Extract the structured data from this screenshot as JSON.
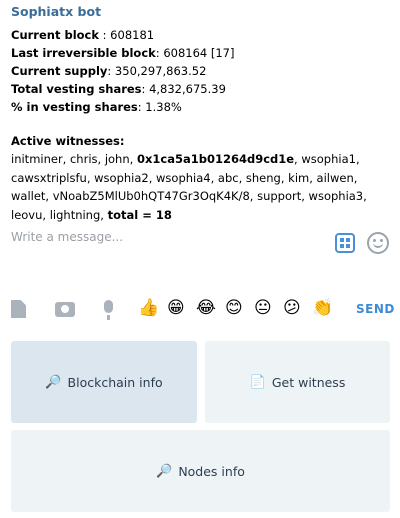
{
  "message": {
    "sender": "Sophiatx bot",
    "stats": [
      {
        "label": "Current block",
        "value": " : 608181"
      },
      {
        "label": "Last irreversible block",
        "value": ": 608164 [17]"
      },
      {
        "label": "Current supply",
        "value": ": 350,297,863.52"
      },
      {
        "label": "Total vesting shares",
        "value": ": 4,832,675.39"
      },
      {
        "label": "% in vesting shares",
        "value": ": 1.38%"
      }
    ],
    "witnesses_heading": "Active witnesses:",
    "witnesses_part1": "initminer, chris, john, ",
    "witnesses_bold": "0x1ca5a1b01264d9cd1e",
    "witnesses_part2": ", wsophia1, cawsxtriplsfu, wsophia2, wsophia4, abc, sheng, kim, ailwen, wallet, vNoabZ5MlUb0hQT47Gr3OqK4K/8, support, wsophia3, leovu, lightning, ",
    "total_text": "total = 18"
  },
  "composer": {
    "placeholder": "Write a message...",
    "keyboard_icon": "keyboard-grid-icon",
    "emoji_icon": "smiley-icon"
  },
  "toolbar": {
    "emojis": [
      "👍",
      "😁",
      "😂",
      "😊",
      "😐",
      "😕",
      "👏"
    ],
    "send_label": "SEND"
  },
  "keyboard": {
    "buttons": [
      {
        "icon": "🔎",
        "label": "Blockchain info"
      },
      {
        "icon": "📄",
        "label": "Get witness"
      },
      {
        "icon": "🔎",
        "label": "Nodes info"
      }
    ]
  },
  "colors": {
    "accent": "#3f8ad6",
    "sender": "#3a6d99",
    "button_bg": "#eef3f6",
    "button_active_bg": "#dbe6ef"
  }
}
